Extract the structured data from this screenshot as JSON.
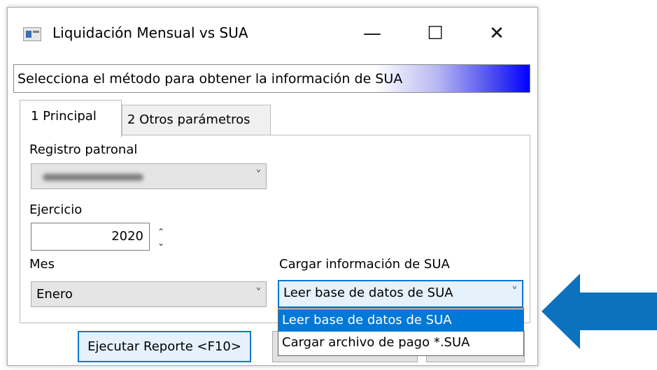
{
  "window": {
    "title": "Liquidación Mensual vs SUA",
    "controls": {
      "minimize": "—",
      "maximize": "☐",
      "close": "✕"
    }
  },
  "banner": {
    "text": "Selecciona el método para obtener la información de SUA",
    "gradient_end_color": "#0000ff"
  },
  "tabs": [
    {
      "label": "1 Principal",
      "active": true
    },
    {
      "label": "2 Otros parámetros",
      "active": false
    }
  ],
  "form": {
    "registro_patronal": {
      "label": "Registro patronal",
      "value_redacted": true
    },
    "ejercicio": {
      "label": "Ejercicio",
      "value": "2020"
    },
    "mes": {
      "label": "Mes",
      "value": "Enero"
    },
    "cargar_sua": {
      "label": "Cargar información de SUA",
      "value": "Leer base de datos de SUA",
      "options": [
        "Leer base de datos de SUA",
        "Cargar archivo de pago *.SUA"
      ],
      "highlighted_option": 0
    }
  },
  "buttons": {
    "run": "Ejecutar Reporte <F10>"
  },
  "icons": {
    "chevron": "˅",
    "spin_up": "⌃",
    "spin_down": "⌄"
  },
  "colors": {
    "accent": "#0078d7",
    "arrow": "#0c72bd"
  }
}
